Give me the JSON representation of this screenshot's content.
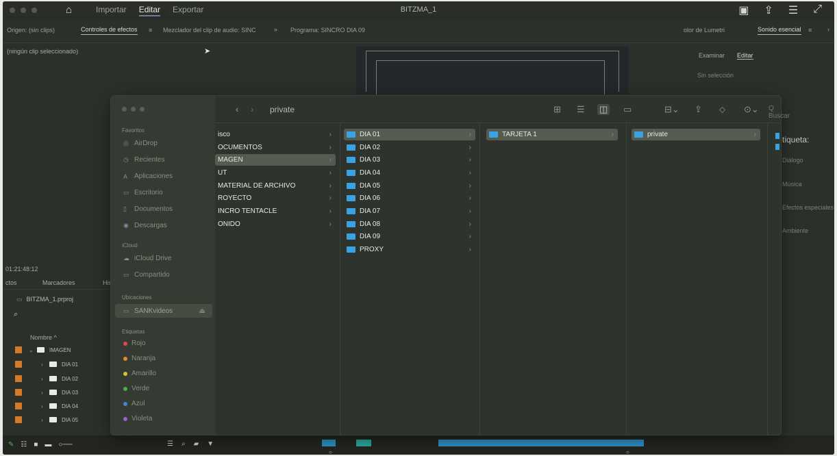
{
  "app": {
    "title": "BITZMA_1",
    "nav": [
      "Importar",
      "Editar",
      "Exportar"
    ],
    "active_nav": "Editar"
  },
  "panels": {
    "source": "Origen: (sin clips)",
    "effects_tab": "Controles de efectos",
    "audio_mixer": "Mezclador del clip de audio: SINC",
    "program": "Programa: SINCRO DIA 09",
    "menu_glyph": "≡",
    "more_glyph": "»",
    "lumetri": "olor de Lumetri",
    "essential_sound": "Sonido esencial",
    "close_glyph": "›",
    "no_clip": "(ningún clip seleccionado)"
  },
  "essential_sound": {
    "tabs": [
      "Examinar",
      "Editar"
    ],
    "active_tab": "Editar",
    "no_selection": "Sin selección",
    "label": "tiqueta:",
    "items": [
      "Diálogo",
      "Música",
      "Efectos especiales",
      "Ambiente"
    ]
  },
  "project": {
    "timecode": "01:21:48:12",
    "tabs": [
      "ctos",
      "Marcadores",
      "His"
    ],
    "file": "BITZMA_1.prproj",
    "column_header": "Nombre ^",
    "rows": [
      {
        "label": "IMAGEN",
        "expanded": true
      },
      {
        "label": "DIA 01"
      },
      {
        "label": "DIA 02"
      },
      {
        "label": "DIA 03"
      },
      {
        "label": "DIA 04"
      },
      {
        "label": "DIA 05"
      }
    ]
  },
  "finder": {
    "path_title": "private",
    "search_placeholder": "Q Buscar",
    "toolbar_icons": [
      "grid-view-icon",
      "list-view-icon",
      "column-view-icon",
      "gallery-view-icon",
      "group-icon",
      "share-icon",
      "tag-icon",
      "action-menu-icon"
    ],
    "sidebar": {
      "favorites_header": "Favoritos",
      "favorites": [
        {
          "label": "AirDrop",
          "icon": "airdrop-icon"
        },
        {
          "label": "Recientes",
          "icon": "clock-icon"
        },
        {
          "label": "Aplicaciones",
          "icon": "apps-icon"
        },
        {
          "label": "Escritorio",
          "icon": "desktop-icon"
        },
        {
          "label": "Documentos",
          "icon": "document-icon"
        },
        {
          "label": "Descargas",
          "icon": "download-icon"
        }
      ],
      "icloud_header": "iCloud",
      "icloud": [
        {
          "label": "iCloud Drive",
          "icon": "cloud-icon"
        },
        {
          "label": "Compartido",
          "icon": "shared-folder-icon"
        }
      ],
      "locations_header": "Ubicaciones",
      "locations": [
        {
          "label": "SANKvideos",
          "icon": "disk-icon"
        }
      ],
      "tags_header": "Etiquetas",
      "tags": [
        {
          "label": "Rojo",
          "color": "#d94a4a"
        },
        {
          "label": "Naranja",
          "color": "#e08a2e"
        },
        {
          "label": "Amarillo",
          "color": "#d9c23a"
        },
        {
          "label": "Verde",
          "color": "#4fae4a"
        },
        {
          "label": "Azul",
          "color": "#3d86d8"
        },
        {
          "label": "Violeta",
          "color": "#9a63c8"
        }
      ]
    },
    "col1": [
      "isco",
      "OCUMENTOS",
      "MAGEN",
      "UT",
      "MATERIAL DE ARCHIVO",
      "ROYECTO",
      "INCRO TENTACLE",
      "ONIDO"
    ],
    "col1_selected": "MAGEN",
    "col2": [
      "DIA 01",
      "DIA 02",
      "DIA 03",
      "DIA 04",
      "DIA 05",
      "DIA 06",
      "DIA 07",
      "DIA 08",
      "DIA 09",
      "PROXY"
    ],
    "col2_selected": "DIA 01",
    "col3": [
      "TARJETA 1"
    ],
    "col3_selected": "TARJETA 1",
    "col4": [
      "private"
    ],
    "col4_selected": "private"
  },
  "colors": {
    "folder_blue": "#3aa2e0",
    "timeline_blue": "#2e8fc4",
    "premiere_orange": "#d17a2c"
  }
}
